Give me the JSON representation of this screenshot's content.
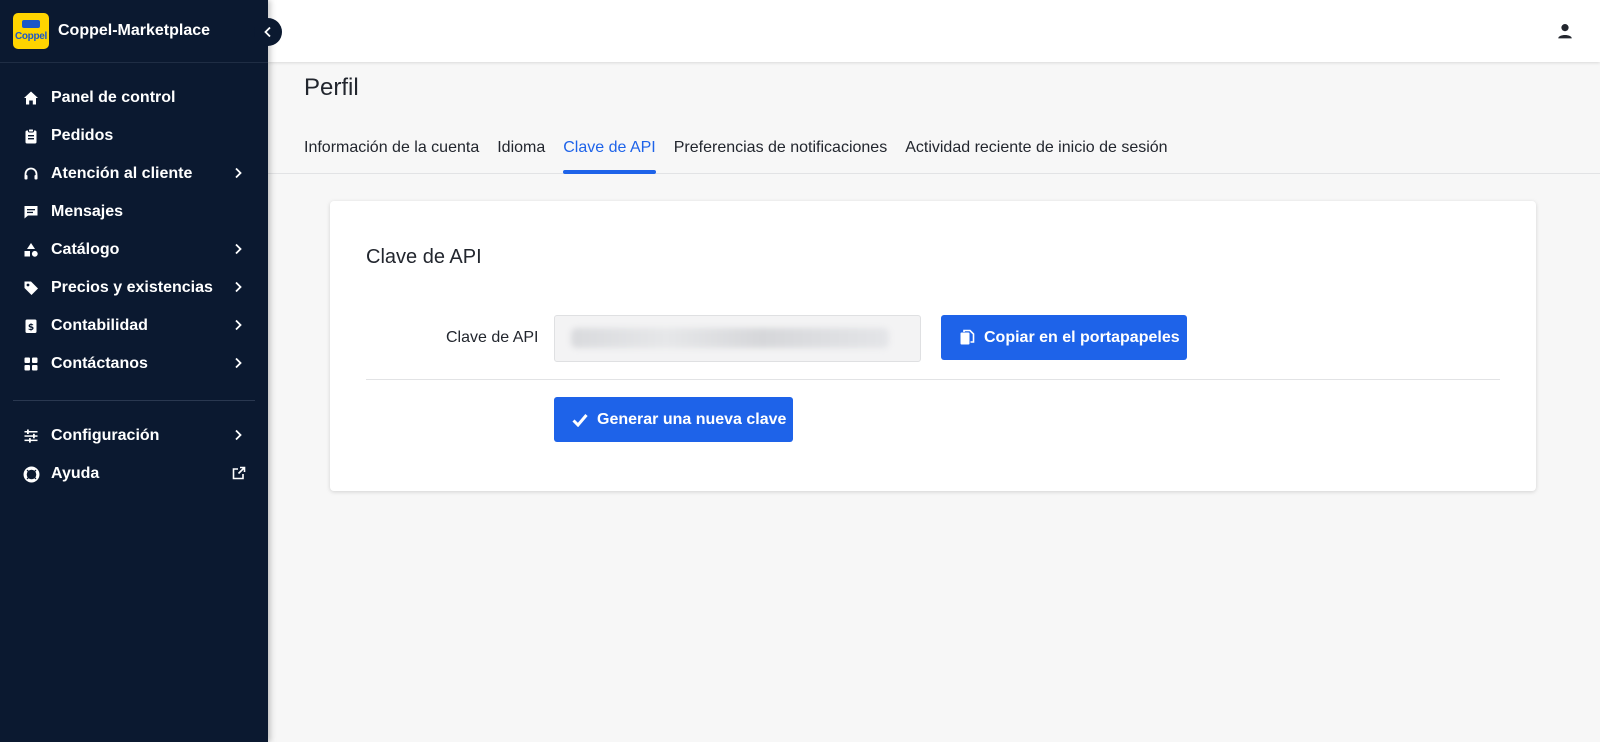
{
  "app": {
    "name": "Coppel-Marketplace",
    "logo_text": "Coppel"
  },
  "sidebar": {
    "items": [
      {
        "label": "Panel de control",
        "icon": "home-icon"
      },
      {
        "label": "Pedidos",
        "icon": "clipboard-icon"
      },
      {
        "label": "Atención al cliente",
        "icon": "headset-icon",
        "has_submenu": true
      },
      {
        "label": "Mensajes",
        "icon": "message-icon"
      },
      {
        "label": "Catálogo",
        "icon": "shapes-icon",
        "has_submenu": true
      },
      {
        "label": "Precios y existencias",
        "icon": "tag-icon",
        "has_submenu": true
      },
      {
        "label": "Contabilidad",
        "icon": "invoice-icon",
        "has_submenu": true
      },
      {
        "label": "Contáctanos",
        "icon": "grid-icon",
        "has_submenu": true
      }
    ],
    "bottom_items": [
      {
        "label": "Configuración",
        "icon": "sliders-icon",
        "has_submenu": true
      },
      {
        "label": "Ayuda",
        "icon": "lifebuoy-icon",
        "external": true
      }
    ]
  },
  "page": {
    "title": "Perfil",
    "tabs": [
      {
        "label": "Información de la cuenta",
        "active": false
      },
      {
        "label": "Idioma",
        "active": false
      },
      {
        "label": "Clave de API",
        "active": true
      },
      {
        "label": "Preferencias de notificaciones",
        "active": false
      },
      {
        "label": "Actividad reciente de inicio de sesión",
        "active": false
      }
    ]
  },
  "card": {
    "title": "Clave de API",
    "field_label": "Clave de API",
    "copy_button": "Copiar en el portapapeles",
    "generate_button": "Generar una nueva clave"
  },
  "colors": {
    "sidebar_bg": "#0b1930",
    "accent": "#1e63e9",
    "page_bg": "#f7f7f7"
  }
}
